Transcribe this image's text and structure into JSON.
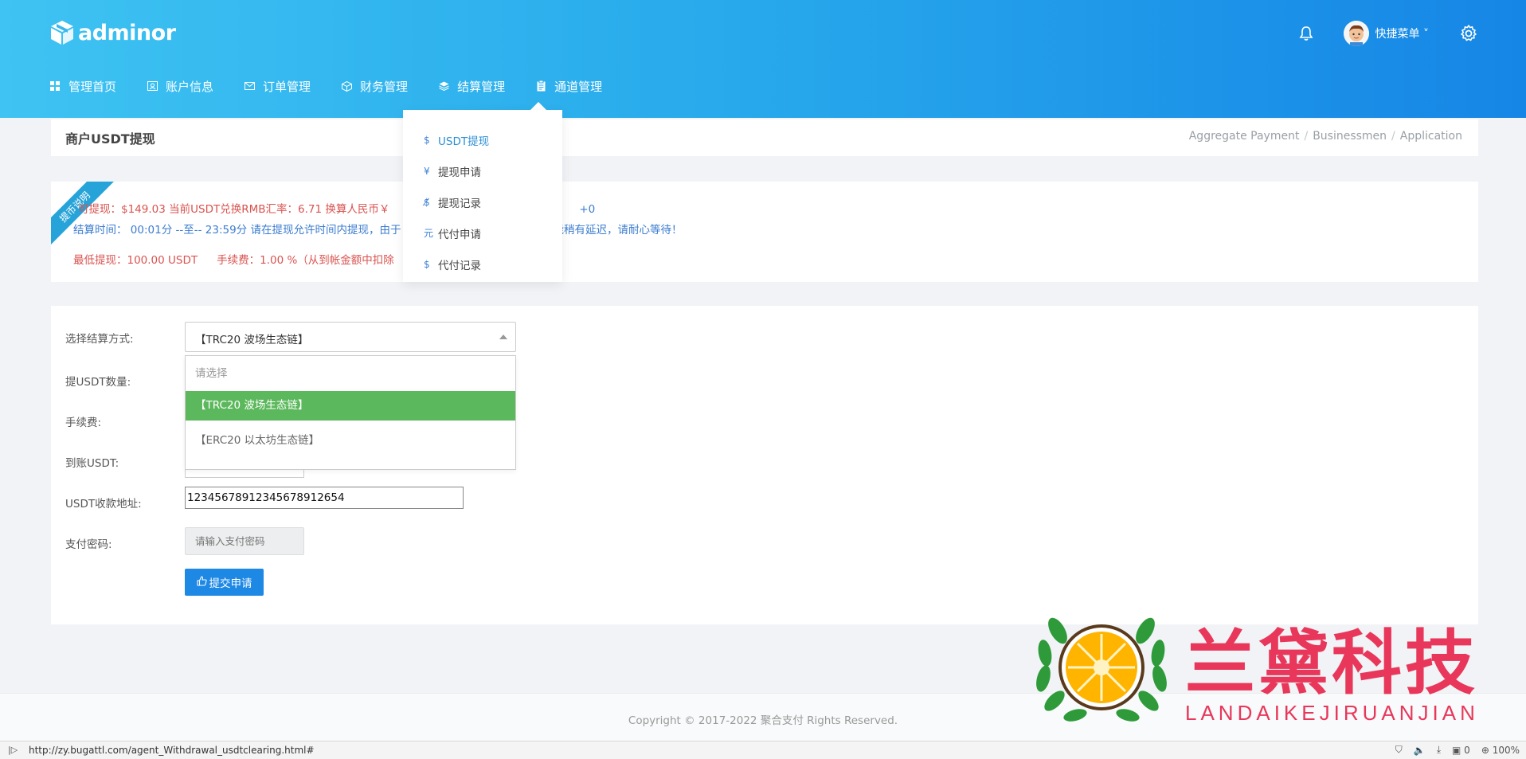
{
  "app": {
    "logo_text": "adminor"
  },
  "header": {
    "quick_menu_label": "快捷菜单 ˅"
  },
  "nav": {
    "items": [
      {
        "label": "管理首页",
        "icon": "grid-icon"
      },
      {
        "label": "账户信息",
        "icon": "user-card-icon"
      },
      {
        "label": "订单管理",
        "icon": "envelope-icon"
      },
      {
        "label": "财务管理",
        "icon": "cube-icon"
      },
      {
        "label": "结算管理",
        "icon": "layers-icon"
      },
      {
        "label": "通道管理",
        "icon": "clipboard-icon"
      }
    ]
  },
  "dropdown": {
    "items": [
      {
        "symbol": "$",
        "label": "USDT提现",
        "active": true
      },
      {
        "symbol": "¥",
        "label": "提现申请"
      },
      {
        "symbol": "$̸",
        "label": "提现记录"
      },
      {
        "symbol": "元",
        "label": "代付申请"
      },
      {
        "symbol": "$",
        "label": "代付记录"
      }
    ]
  },
  "page": {
    "title": "商户USDT提现",
    "breadcrumb": [
      "Aggregate Payment",
      "Businessmen",
      "Application"
    ]
  },
  "notice": {
    "ribbon": "提币说明",
    "line1_left": "可提现：$149.03  当前USDT兑换RMB汇率：6.71   换算人民币￥",
    "line1_right": "+0",
    "line2_left": "结算时间：  00:01分 --至-- 23:59分 请在提现允许时间内提现，由于",
    "line2_right": "，到账时间可能稍有延迟，请耐心等待！",
    "line3_min": "最低提现：100.00 USDT",
    "line3_fee": "手续费：1.00 %（从到帐金额中扣除"
  },
  "form": {
    "settle_label": "选择结算方式:",
    "settle_value": "【TRC20 波场生态链】",
    "settle_options": {
      "placeholder": "请选择",
      "selected": "【TRC20 波场生态链】",
      "other": "【ERC20 以太坊生态链】"
    },
    "amount_label": "提USDT数量:",
    "fee_label": "手续费:",
    "arrive_label": "到账USDT:",
    "address_label": "USDT收款地址:",
    "address_value": "12345678912345678912654",
    "password_label": "支付密码:",
    "password_placeholder": "请输入支付密码",
    "submit_label": "提交申请"
  },
  "footer": {
    "copyright": "Copyright © 2017-2022 聚合支付 Rights Reserved."
  },
  "watermark": {
    "title": "兰黛科技",
    "subtitle": "LANDAIKEJIRUANJIAN"
  },
  "statusbar": {
    "url": "http://zy.bugattl.com/agent_Withdrawal_usdtclearing.html#",
    "count": "0",
    "zoom": "100%"
  },
  "colors": {
    "header_start": "#3ec3f2",
    "header_end": "#1686e6",
    "selected_option": "#5cb85c",
    "submit": "#1e88e5",
    "warning_text": "#d9534f",
    "info_text": "#3b7ccf",
    "watermark": "#e8375a"
  }
}
